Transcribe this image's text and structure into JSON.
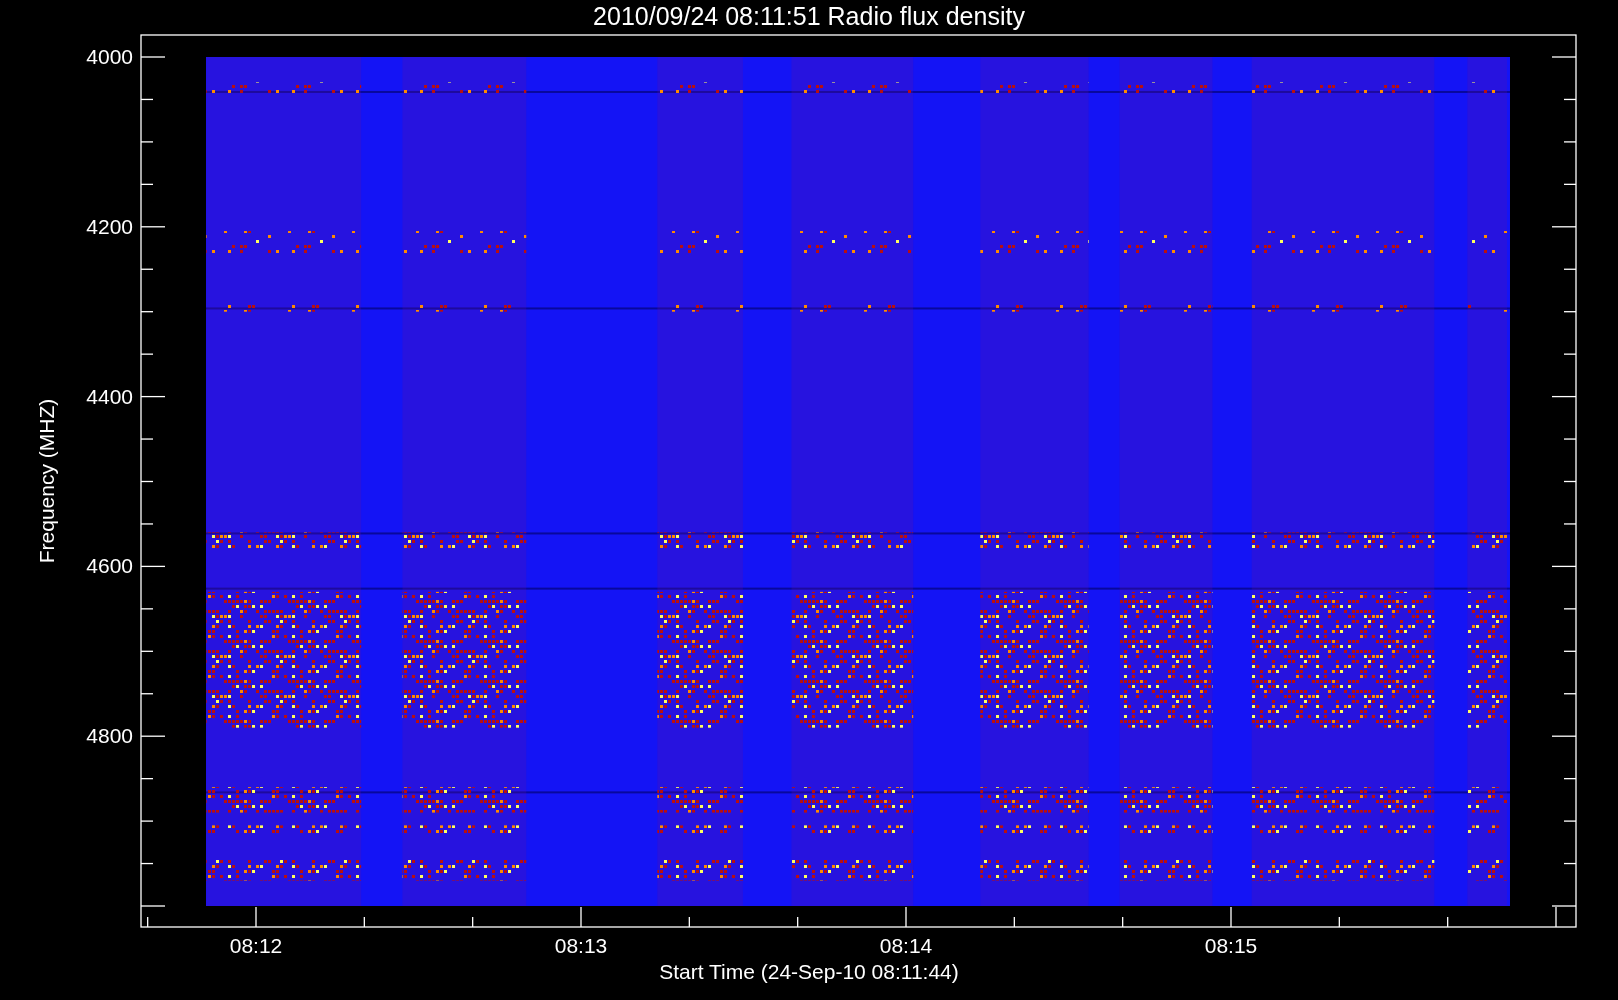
{
  "title": "2010/09/24 08:11:51 Radio flux density",
  "y_axis": {
    "label": "Frequency (MHZ)",
    "ticks": [
      "4000",
      "4200",
      "4400",
      "4600",
      "4800"
    ]
  },
  "x_axis": {
    "label": "Start Time (24-Sep-10 08:11:44)",
    "ticks": [
      "08:12",
      "08:13",
      "08:14",
      "08:15"
    ]
  }
}
